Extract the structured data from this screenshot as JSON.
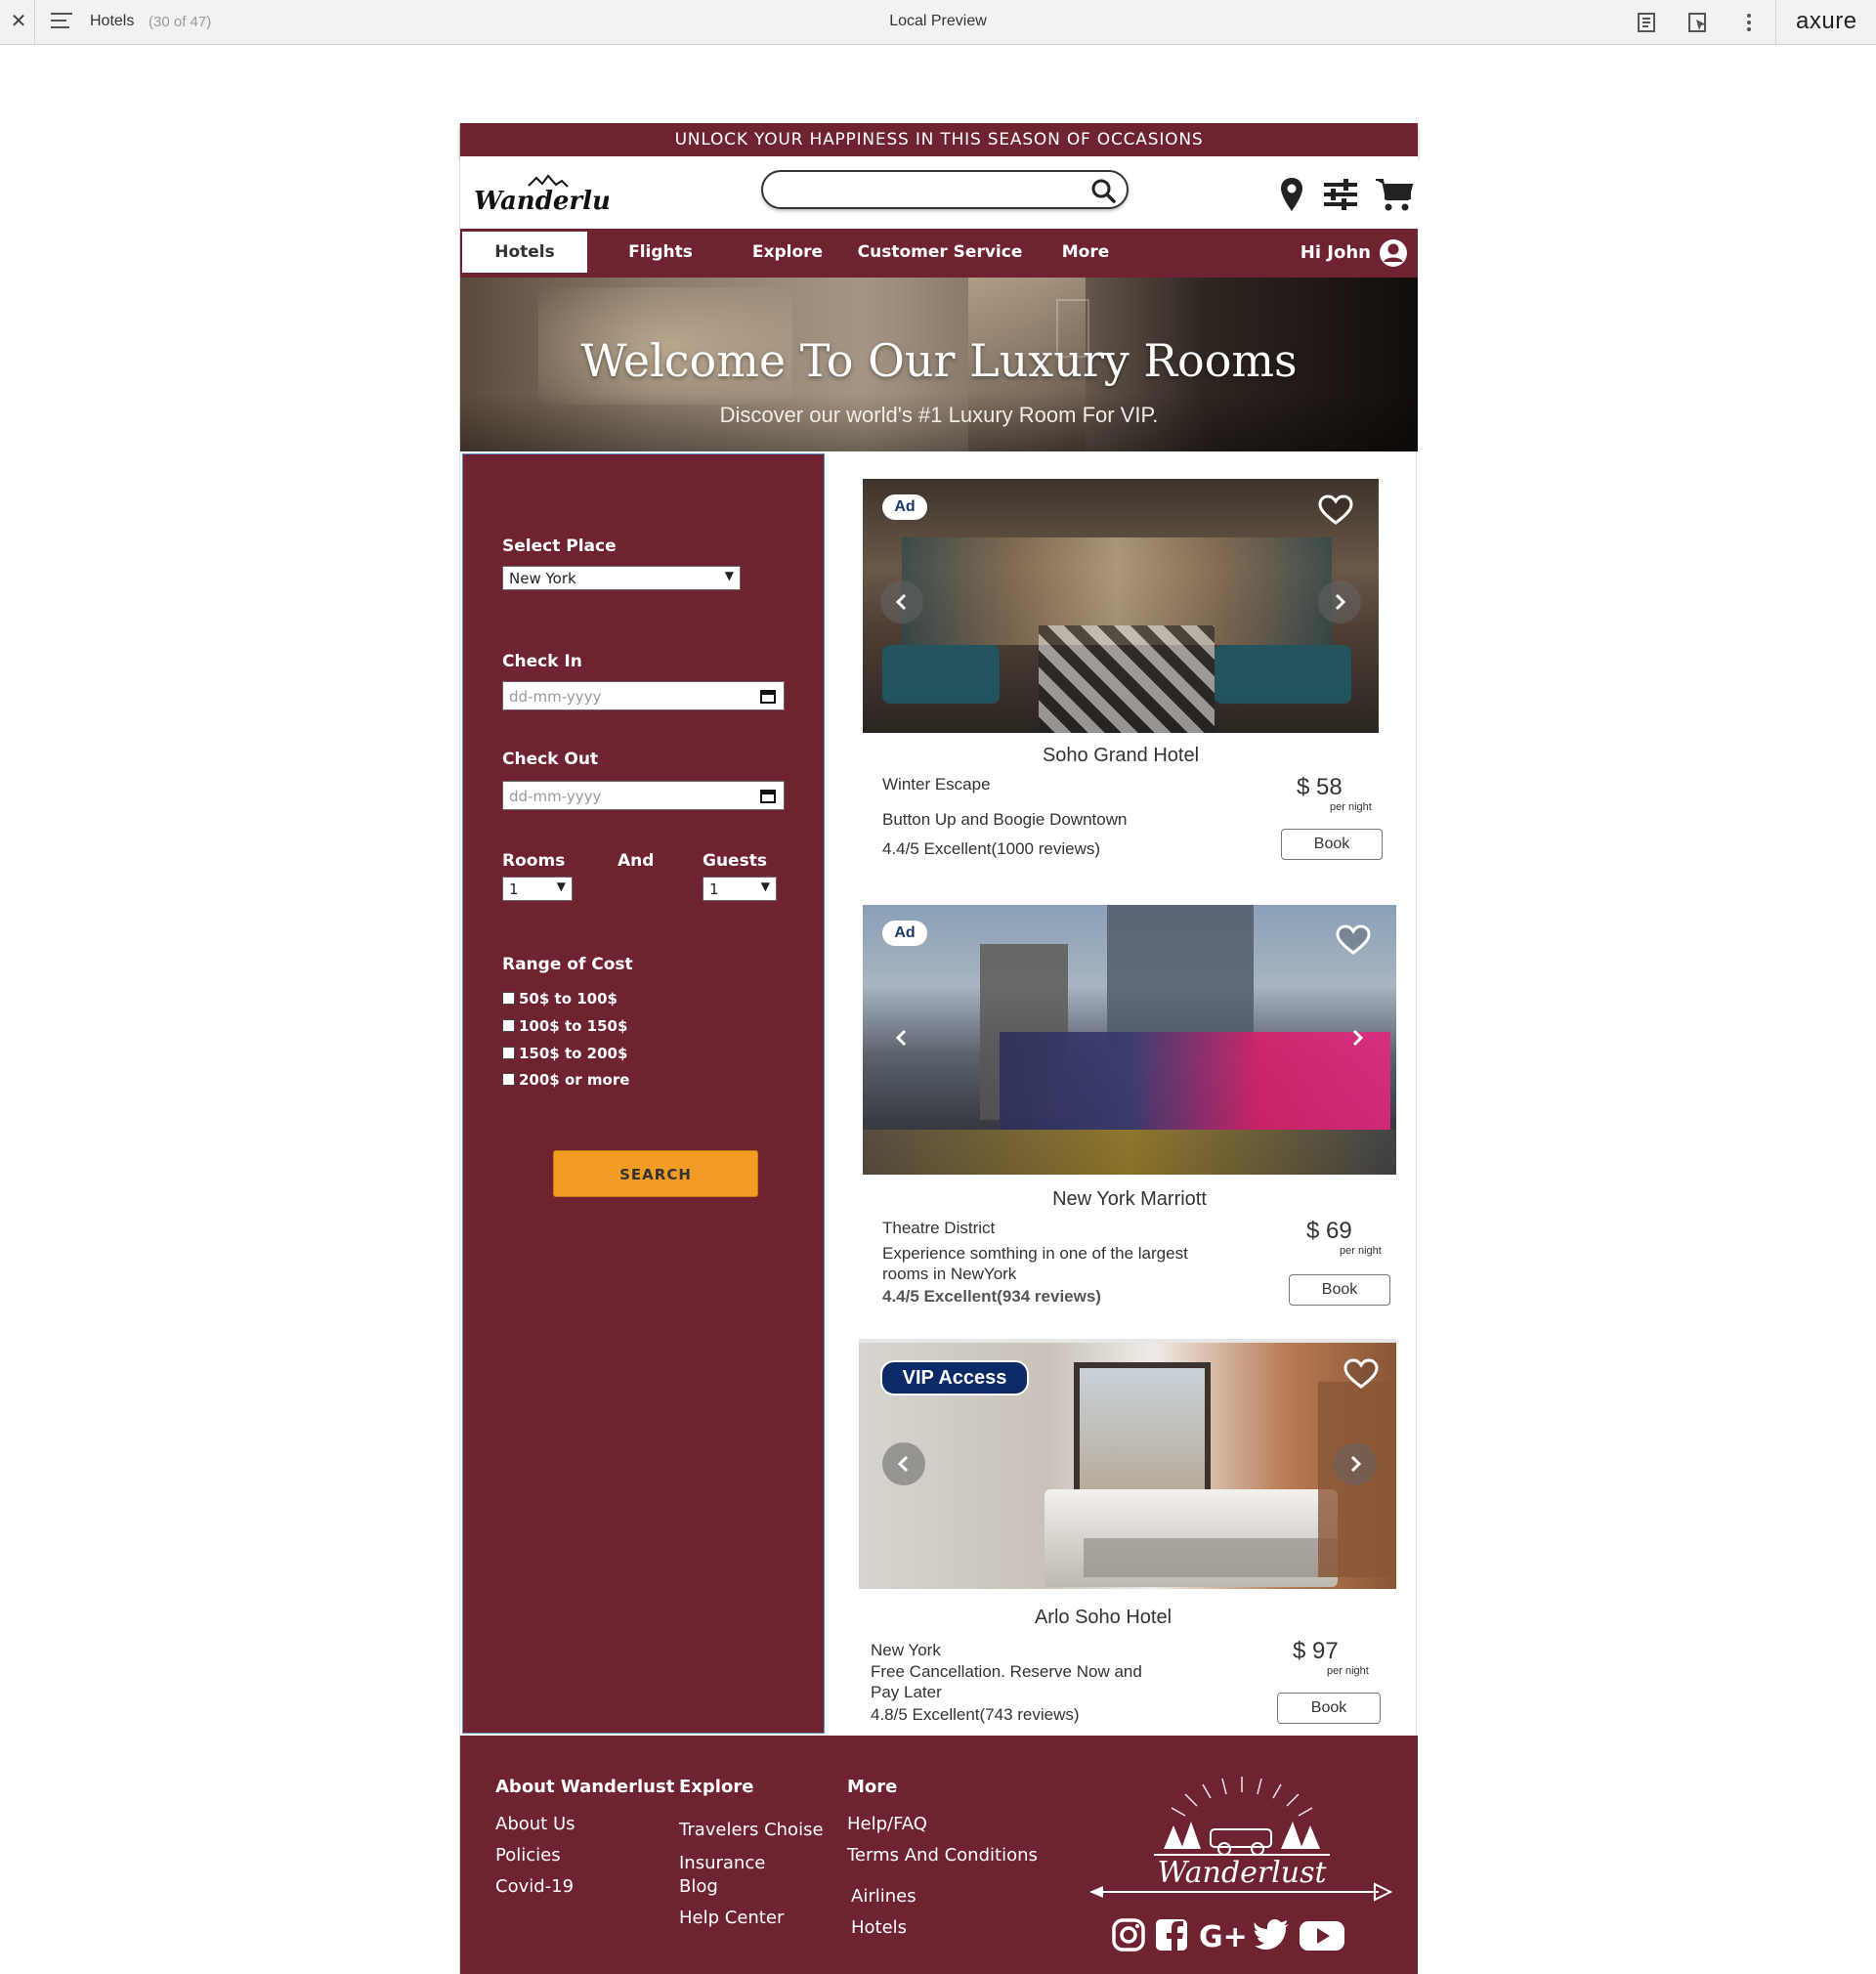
{
  "toolbar": {
    "page_name": "Hotels",
    "page_count": "(30 of 47)",
    "title": "Local Preview",
    "brand": "axure"
  },
  "promo": {
    "text": "UNLOCK YOUR HAPPINESS IN THIS SEASON OF OCCASIONS"
  },
  "header": {
    "search_placeholder": "",
    "icons": [
      "location-pin-icon",
      "filter-sliders-icon",
      "cart-icon"
    ]
  },
  "nav": {
    "items": [
      "Hotels",
      "Flights",
      "Explore",
      "Customer Service",
      "More"
    ],
    "active": "Hotels",
    "user_greeting": "Hi John"
  },
  "hero": {
    "title": "Welcome To Our Luxury Rooms",
    "subtitle": "Discover our world's #1 Luxury Room For VIP."
  },
  "filters": {
    "place_label": "Select Place",
    "place_value": "New York",
    "checkin_label": "Check In",
    "checkin_placeholder": "dd-mm-yyyy",
    "checkout_label": "Check Out",
    "checkout_placeholder": "dd-mm-yyyy",
    "rooms_label": "Rooms",
    "and_label": "And",
    "guests_label": "Guests",
    "rooms_value": "1",
    "guests_value": "1",
    "cost_label": "Range of Cost",
    "cost_options": [
      "50$ to 100$",
      "100$ to 150$",
      "150$ to 200$",
      "200$ or more"
    ],
    "search_button": "SEARCH"
  },
  "hotels": [
    {
      "badge": "Ad",
      "name": "Soho Grand Hotel",
      "line1": "Winter Escape",
      "line2": "Button Up and Boogie Downtown",
      "rating": "4.4/5 Excellent(1000 reviews)",
      "price": "$ 58",
      "per_night": "per night",
      "book": "Book"
    },
    {
      "badge": "Ad",
      "name": "New York Marriott",
      "line1": "Theatre District",
      "line2": "Experience somthing in one of the largest rooms in NewYork",
      "rating": "4.4/5 Excellent(934 reviews)",
      "price": "$ 69",
      "per_night": "per night",
      "book": "Book"
    },
    {
      "badge": "VIP Access",
      "name": "Arlo Soho Hotel",
      "line1": "New York",
      "line2": "Free Cancellation. Reserve Now and Pay Later",
      "rating": "4.8/5 Excellent(743 reviews)",
      "price": "$ 97",
      "per_night": "per night",
      "book": "Book"
    }
  ],
  "footer": {
    "col1": {
      "heading": "About Wanderlust",
      "links": [
        "About Us",
        "Policies",
        "Covid-19"
      ]
    },
    "col2": {
      "heading": "Explore",
      "links": [
        "Travelers Choise",
        "Insurance",
        "Blog",
        "Help Center"
      ]
    },
    "col3": {
      "heading": "More",
      "links": [
        "Help/FAQ",
        "Terms And Conditions",
        "Airlines",
        "Hotels"
      ]
    },
    "brand": "Wanderlust",
    "social": [
      "instagram-icon",
      "facebook-icon",
      "google-plus-icon",
      "twitter-icon",
      "youtube-icon"
    ]
  },
  "colors": {
    "brand": "#6f2331",
    "accent": "#f39c24",
    "vip": "#0b2a66"
  }
}
